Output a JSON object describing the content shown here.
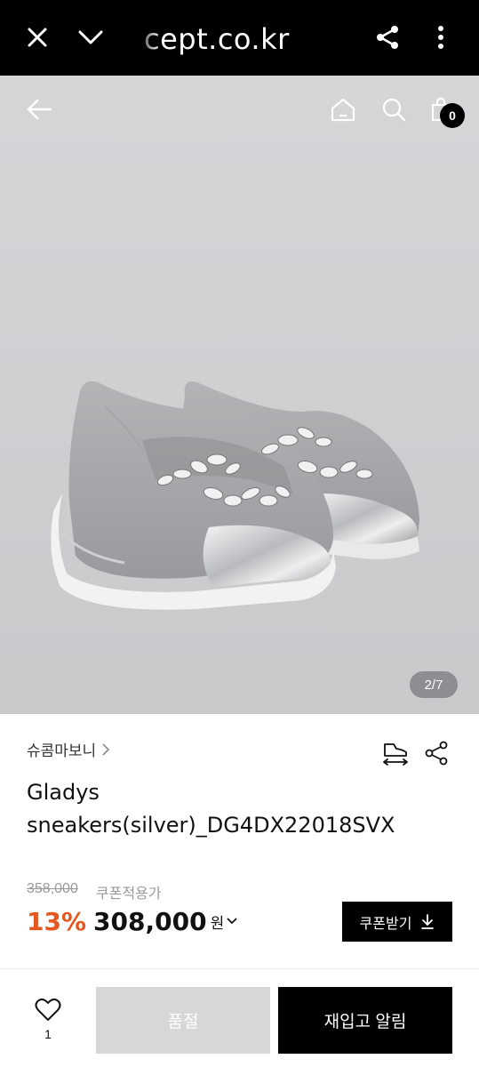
{
  "browser": {
    "url": "cept.co.kr"
  },
  "header": {
    "cart_count": "0"
  },
  "gallery": {
    "counter": "2/7"
  },
  "product": {
    "brand": "슈콤마보니",
    "title_line1": "Gladys",
    "title_line2": "sneakers(silver)_DG4DX22018SVX",
    "original_price": "358,000",
    "coupon_note": "쿠폰적용가",
    "discount": "13%",
    "price": "308,000",
    "currency": "원"
  },
  "actions": {
    "coupon_button": "쿠폰받기",
    "like_count": "1",
    "soldout_button": "품절",
    "restock_button": "재입고 알림"
  },
  "colors": {
    "accent_discount": "#e4571e",
    "bar_bg": "#000000",
    "soldout_bg": "#d7d7d7"
  }
}
